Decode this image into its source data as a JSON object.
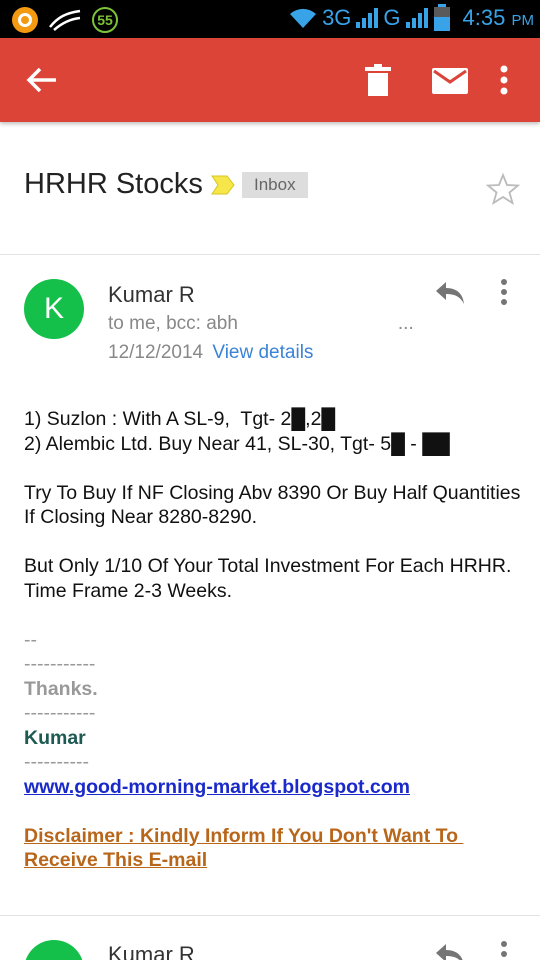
{
  "status_bar": {
    "notification_badge": "55",
    "network_3g": "3G",
    "network_g": "G",
    "time": "4:35",
    "time_suffix": "PM"
  },
  "app_bar": {
    "icons": [
      "back-arrow-icon",
      "trash-icon",
      "mail-icon",
      "more-vert-icon"
    ]
  },
  "thread": {
    "subject": "HRHR Stocks",
    "label": "Inbox"
  },
  "message": {
    "sender": "Kumar R",
    "avatar_letter": "K",
    "recipients": "to me, bcc: abh",
    "recipients_more": "...",
    "date": "12/12/2014",
    "view_details": "View details",
    "body": {
      "line1": "1) Suzlon : With A SL-9,  Tgt- 2█,2█",
      "line2": "2) Alembic Ltd. Buy Near 41, SL-30, Tgt- 5█ - ██",
      "para2": "Try To Buy If NF Closing Abv 8390 Or Buy Half Quantities If Closing Near 8280-8290.",
      "para3": "But Only 1/10 Of Your Total Investment For Each HRHR.",
      "para3b": "Time Frame 2-3 Weeks.",
      "sig_sep": "--",
      "sig_dash1": "-----------",
      "sig_thanks": "Thanks.",
      "sig_dash2": "-----------",
      "sig_name": "Kumar",
      "sig_dash3": "----------",
      "sig_link": "www.good-morning-market.blogspot.com",
      "disclaimer": "Disclaimer : Kindly Inform If You Don't Want To Receive This E-mail"
    }
  },
  "next_message": {
    "sender": "Kumar R"
  },
  "colors": {
    "app_bar": "#db4437",
    "avatar": "#14c04a",
    "link": "#3a83d6"
  }
}
